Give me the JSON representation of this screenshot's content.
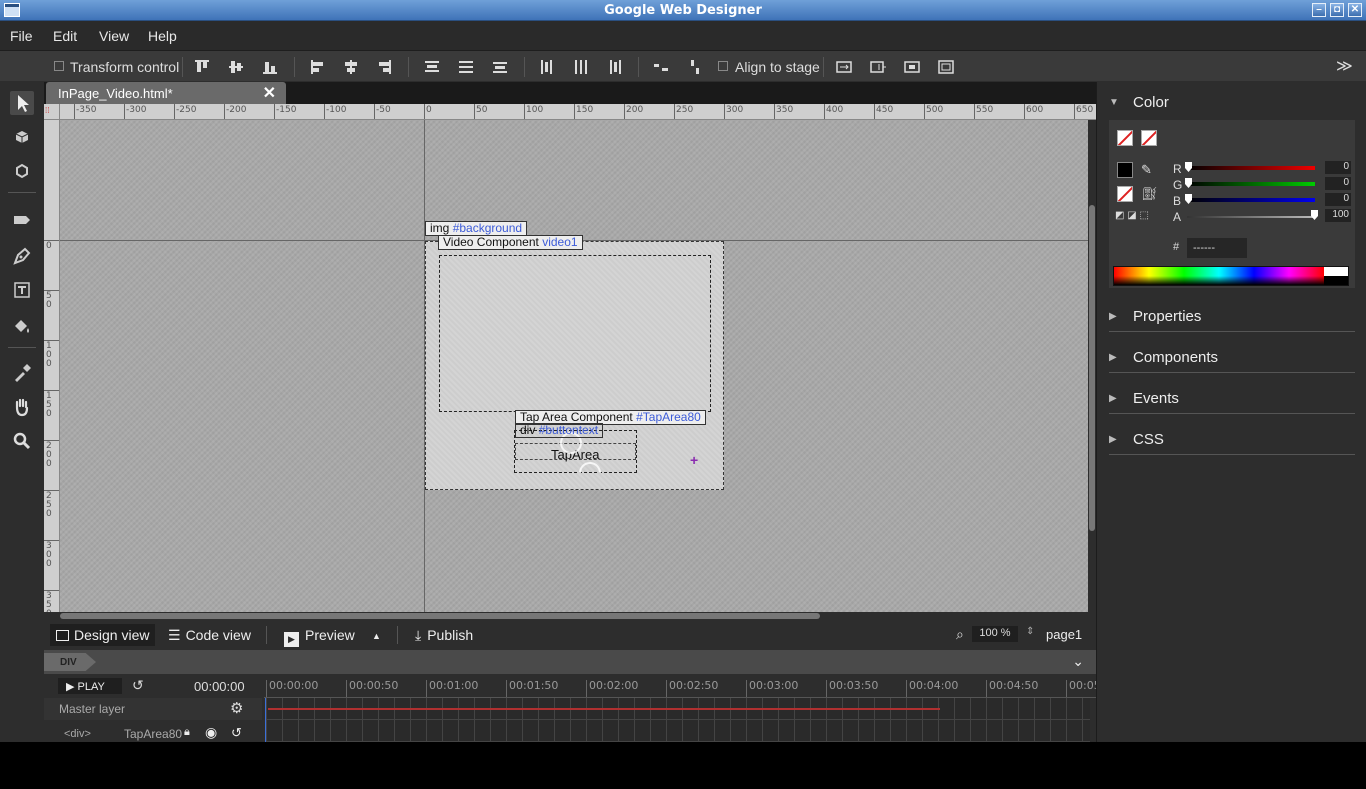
{
  "window": {
    "title": "Google Web Designer",
    "controls": [
      "minimize",
      "restore",
      "close"
    ]
  },
  "menu": [
    "File",
    "Edit",
    "View",
    "Help"
  ],
  "toolbar": {
    "transform_control": "Transform control",
    "align_to_stage": "Align to stage",
    "collapse": "≫"
  },
  "doc_tab": {
    "label": "InPage_Video.html*",
    "close": "✕"
  },
  "ruler": {
    "h_labels": [
      "-350",
      "-300",
      "-250",
      "-200",
      "-150",
      "-100",
      "-50",
      "0",
      "50",
      "100",
      "150",
      "200",
      "250",
      "300",
      "350",
      "400",
      "450",
      "500",
      "550",
      "600",
      "650"
    ],
    "v_labels": [
      "0",
      "50",
      "100",
      "150",
      "200",
      "250",
      "300",
      "350"
    ]
  },
  "stage": {
    "labels": {
      "background": {
        "tag": "img",
        "id": "#background"
      },
      "video": {
        "tag": "Video Component",
        "id": "video1"
      },
      "taparea": {
        "tag": "Tap Area Component",
        "id": "#TapArea80"
      },
      "buttontext": {
        "tag": "div",
        "id": "#buttontext"
      }
    },
    "taparea_text": "TapArea"
  },
  "viewbar": {
    "design_view": "Design view",
    "code_view": "Code view",
    "preview": "Preview",
    "publish": "Publish",
    "zoom": "100 %",
    "page": "page1"
  },
  "timeline": {
    "crumb": "DIV",
    "play": "PLAY",
    "current_time": "00:00:00",
    "master_layer": "Master layer",
    "layer_tag": "<div>",
    "layer_name": "TapArea80",
    "times": [
      "00:00:00",
      "00:00:50",
      "00:01:00",
      "00:01:50",
      "00:02:00",
      "00:02:50",
      "00:03:00",
      "00:03:50",
      "00:04:00",
      "00:04:50",
      "00:05"
    ]
  },
  "panel": {
    "color": {
      "title": "Color",
      "r": "0",
      "g": "0",
      "b": "0",
      "a": "100",
      "hash": "#",
      "hex": "------",
      "labels": {
        "r": "R",
        "g": "G",
        "b": "B",
        "a": "A"
      }
    },
    "sections": [
      "Properties",
      "Components",
      "Events",
      "CSS"
    ]
  },
  "colors": {
    "titlebar": "#3f73b8",
    "id_blue": "#3c5bd8",
    "timeline_red": "#c0392b"
  }
}
